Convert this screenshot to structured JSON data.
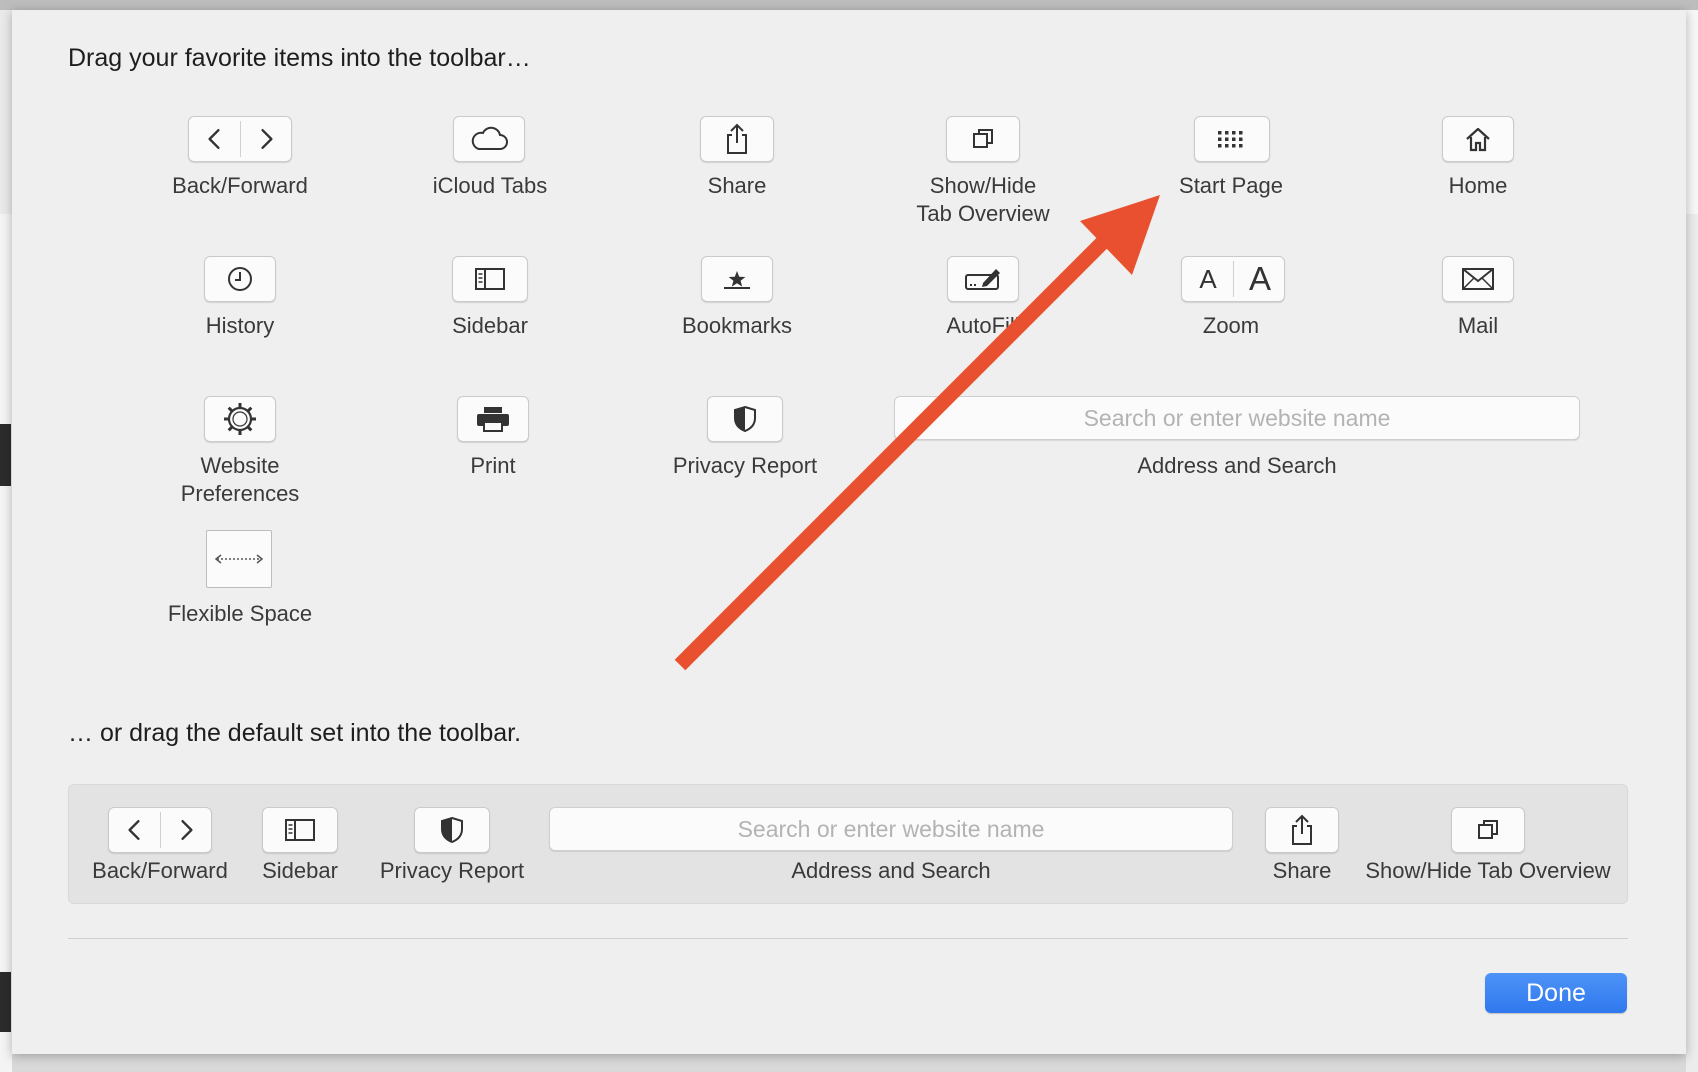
{
  "window": {
    "heading_top": "Drag your favorite items into the toolbar…",
    "heading_bottom": "… or drag the default set into the toolbar."
  },
  "palette": {
    "back_forward": "Back/Forward",
    "icloud_tabs": "iCloud Tabs",
    "share": "Share",
    "tab_overview_line1": "Show/Hide",
    "tab_overview_line2": "Tab Overview",
    "start_page": "Start Page",
    "home": "Home",
    "history": "History",
    "sidebar": "Sidebar",
    "bookmarks": "Bookmarks",
    "autofill": "AutoFill",
    "zoom": "Zoom",
    "zoom_small_glyph": "A",
    "zoom_large_glyph": "A",
    "mail": "Mail",
    "website_prefs_line1": "Website",
    "website_prefs_line2": "Preferences",
    "print": "Print",
    "privacy_report": "Privacy Report",
    "address_placeholder": "Search or enter website name",
    "address_label": "Address and Search",
    "flexible_space": "Flexible Space"
  },
  "default_set": {
    "back_forward": "Back/Forward",
    "sidebar": "Sidebar",
    "privacy_report": "Privacy Report",
    "address_placeholder": "Search or enter website name",
    "address_label": "Address and Search",
    "share": "Share",
    "tab_overview": "Show/Hide Tab Overview"
  },
  "buttons": {
    "done": "Done"
  },
  "colors": {
    "annotation_arrow": "#e8502f",
    "done_button": "#3a82f2"
  }
}
